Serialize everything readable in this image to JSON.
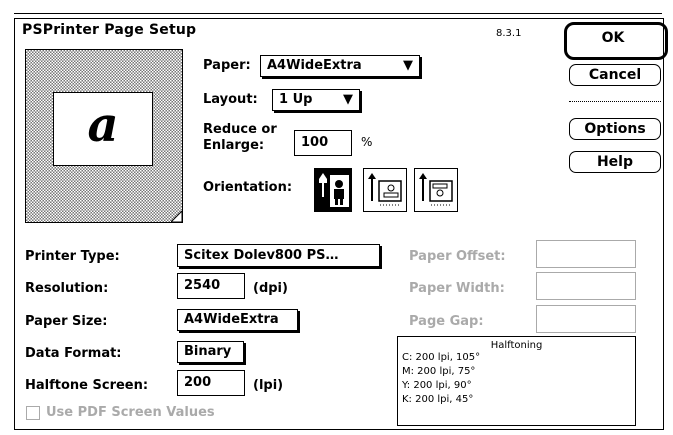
{
  "dialog": {
    "title": "PSPrinter Page Setup",
    "version": "8.3.1"
  },
  "buttons": {
    "ok": "OK",
    "cancel": "Cancel",
    "options": "Options",
    "help": "Help"
  },
  "preview": {
    "glyph": "a"
  },
  "paper": {
    "label": "Paper:",
    "value": "A4WideExtra"
  },
  "layout": {
    "label": "Layout:",
    "value": "1 Up"
  },
  "reduce": {
    "label_line1": "Reduce or",
    "label_line2": "Enlarge:",
    "value": "100",
    "unit": "%"
  },
  "orientation": {
    "label": "Orientation:",
    "selected": "portrait"
  },
  "printer_type": {
    "label": "Printer Type:",
    "value": "Scitex Dolev800 PS…"
  },
  "resolution": {
    "label": "Resolution:",
    "value": "2540",
    "unit": "(dpi)"
  },
  "paper_size": {
    "label": "Paper Size:",
    "value": "A4WideExtra"
  },
  "data_format": {
    "label": "Data Format:",
    "value": "Binary"
  },
  "halftone_screen": {
    "label": "Halftone Screen:",
    "value": "200",
    "unit": "(lpi)"
  },
  "paper_offset": {
    "label": "Paper Offset:",
    "value": ""
  },
  "paper_width": {
    "label": "Paper Width:",
    "value": ""
  },
  "page_gap": {
    "label": "Page Gap:",
    "value": ""
  },
  "halftoning": {
    "title": "Halftoning",
    "rows": [
      "C: 200 lpi, 105°",
      "M: 200 lpi, 75°",
      "Y: 200 lpi, 90°",
      "K: 200 lpi, 45°"
    ]
  },
  "pdf_screen": {
    "label": "Use PDF Screen Values",
    "checked": false
  }
}
